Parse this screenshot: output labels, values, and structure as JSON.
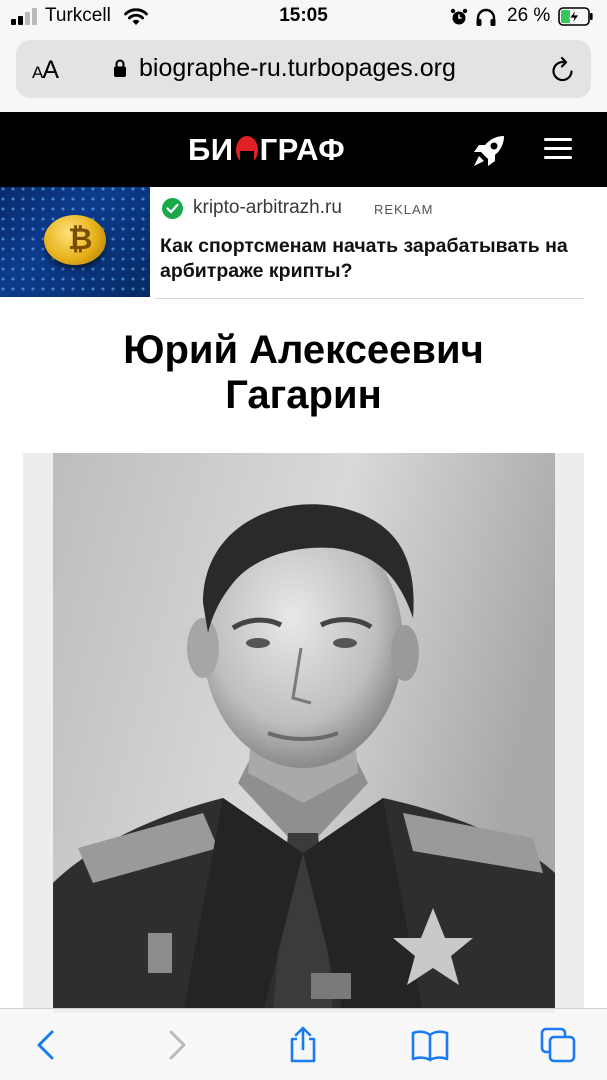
{
  "status_bar": {
    "carrier": "Turkcell",
    "time": "15:05",
    "battery_percent": "26 %",
    "icons": [
      "signal-icon",
      "wifi-icon",
      "alarm-icon",
      "headphones-icon",
      "battery-charging-icon"
    ]
  },
  "browser": {
    "text_size_label_small": "A",
    "text_size_label_large": "A",
    "url": "biographe-ru.turbopages.org",
    "icons": [
      "lock-icon",
      "reload-icon"
    ]
  },
  "site_header": {
    "logo_left": "БИ",
    "logo_right": "ГРАФ",
    "icons": [
      "rocket-icon",
      "menu-icon"
    ]
  },
  "ad": {
    "domain": "kripto-arbitrazh.ru",
    "label": "REKLAM",
    "headline": "Как спортсменам начать зарабатывать на арбитраже крипты?",
    "icons": [
      "verified-check-icon"
    ]
  },
  "article": {
    "title_line1": "Юрий Алексеевич",
    "title_line2": "Гагарин"
  },
  "toolbar": {
    "icons": [
      "back-icon",
      "forward-icon",
      "share-icon",
      "bookmarks-icon",
      "tabs-icon"
    ],
    "accent": "#1a7cf2",
    "disabled": "#b9b9bd"
  },
  "colors": {
    "header_bg": "#000000",
    "logo_accent": "#e01f26",
    "ad_check": "#1ba84a"
  }
}
